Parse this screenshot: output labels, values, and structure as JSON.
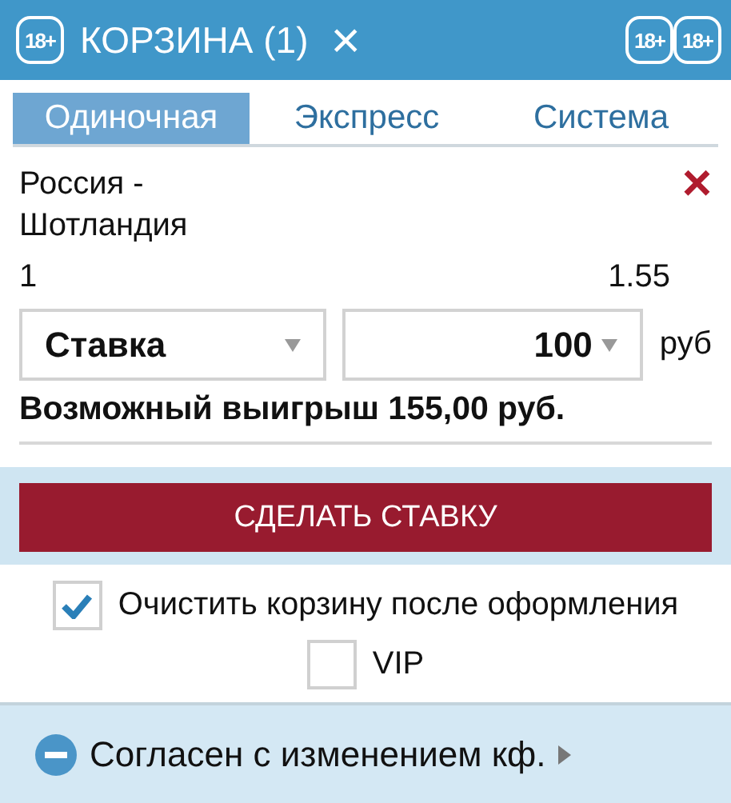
{
  "header": {
    "badges_left": [
      "18+"
    ],
    "title": "КОРЗИНА (1)",
    "close": "×",
    "badges_right": [
      "18+",
      "18+"
    ]
  },
  "tabs": [
    {
      "label": "Одиночная",
      "selected": true
    },
    {
      "label": "Экспресс",
      "selected": false
    },
    {
      "label": "Система",
      "selected": false
    }
  ],
  "bet": {
    "event": "Россия - Шотландия",
    "remove": "×",
    "outcome": "1",
    "odds": "1.55"
  },
  "stake": {
    "type_select": "Ставка",
    "amount": "100",
    "currency": "руб"
  },
  "possible_win": "Возможный выигрыш 155,00 руб.",
  "submit_button": "СДЕЛАТЬ СТАВКУ",
  "options": [
    {
      "label": "Очистить корзину после оформления",
      "checked": true
    },
    {
      "label": "VIP",
      "checked": false
    }
  ],
  "footer": {
    "label": "Согласен с изменением кф.",
    "expanded": false
  }
}
